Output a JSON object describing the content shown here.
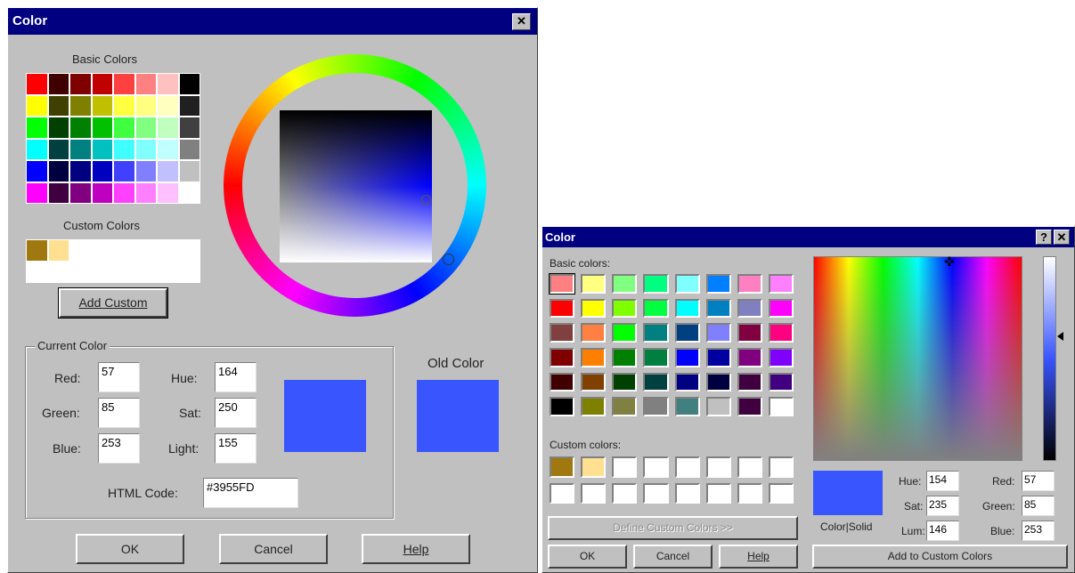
{
  "left_dialog": {
    "title": "Color",
    "close_glyph": "✕",
    "basic_colors_label": "Basic Colors",
    "custom_colors_label": "Custom Colors",
    "add_custom_label": "Add Custom",
    "current_color_label": "Current Color",
    "old_color_label": "Old Color",
    "red_label": "Red:",
    "green_label": "Green:",
    "blue_label": "Blue:",
    "hue_label": "Hue:",
    "sat_label": "Sat:",
    "light_label": "Light:",
    "red_value": "57",
    "green_value": "85",
    "blue_value": "253",
    "hue_value": "164",
    "sat_value": "250",
    "light_value": "155",
    "html_code_label": "HTML Code:",
    "html_code_value": "#3955FD",
    "current_color_hex": "#3955FD",
    "old_color_hex": "#3955FD",
    "ok_label": "OK",
    "cancel_label": "Cancel",
    "help_label": "Help",
    "basic_colors": [
      "#ff0000",
      "#400000",
      "#800000",
      "#c00000",
      "#ff4040",
      "#ff8080",
      "#ffc0c0",
      "#000000",
      "#ffff00",
      "#404000",
      "#808000",
      "#c0c000",
      "#ffff40",
      "#ffff80",
      "#ffffc0",
      "#202020",
      "#00ff00",
      "#004000",
      "#008000",
      "#00c000",
      "#40ff40",
      "#80ff80",
      "#c0ffc0",
      "#404040",
      "#00ffff",
      "#004040",
      "#008080",
      "#00c0c0",
      "#40ffff",
      "#80ffff",
      "#c0ffff",
      "#808080",
      "#0000ff",
      "#000040",
      "#000080",
      "#0000c0",
      "#4040ff",
      "#8080ff",
      "#c0c0ff",
      "#c0c0c0",
      "#ff00ff",
      "#400040",
      "#800080",
      "#c000c0",
      "#ff40ff",
      "#ff80ff",
      "#ffc0ff",
      "#ffffff"
    ],
    "custom_colors": [
      "#a07810",
      "#ffe090",
      "#ffffff",
      "#ffffff",
      "#ffffff",
      "#ffffff",
      "#ffffff",
      "#ffffff",
      "#ffffff",
      "#ffffff",
      "#ffffff",
      "#ffffff",
      "#ffffff",
      "#ffffff",
      "#ffffff",
      "#ffffff"
    ]
  },
  "right_dialog": {
    "title": "Color",
    "help_glyph": "?",
    "close_glyph": "✕",
    "basic_colors_label": "Basic colors:",
    "custom_colors_label": "Custom colors:",
    "define_custom_label": "Define Custom Colors >>",
    "color_solid_label": "Color|Solid",
    "hue_label": "Hue:",
    "sat_label": "Sat:",
    "lum_label": "Lum:",
    "red_label": "Red:",
    "green_label": "Green:",
    "blue_label": "Blue:",
    "hue_value": "154",
    "sat_value": "235",
    "lum_value": "146",
    "red_value": "57",
    "green_value": "85",
    "blue_value": "253",
    "ok_label": "OK",
    "cancel_label": "Cancel",
    "help_label": "Help",
    "add_to_custom_label": "Add to Custom Colors",
    "color_solid_hex": "#3955FD",
    "basic_colors": [
      "#ff8080",
      "#ffff80",
      "#80ff80",
      "#00ff80",
      "#80ffff",
      "#0080ff",
      "#ff80c0",
      "#ff80ff",
      "#ff0000",
      "#ffff00",
      "#80ff00",
      "#00ff40",
      "#00ffff",
      "#0080c0",
      "#8080c0",
      "#ff00ff",
      "#804040",
      "#ff8040",
      "#00ff00",
      "#008080",
      "#004080",
      "#8080ff",
      "#800040",
      "#ff0080",
      "#800000",
      "#ff8000",
      "#008000",
      "#008040",
      "#0000ff",
      "#0000a0",
      "#800080",
      "#8000ff",
      "#400000",
      "#804000",
      "#004000",
      "#004040",
      "#000080",
      "#000040",
      "#400040",
      "#400080",
      "#000000",
      "#808000",
      "#808040",
      "#808080",
      "#408080",
      "#c0c0c0",
      "#400040",
      "#ffffff"
    ],
    "custom_colors": [
      "#a07810",
      "#ffe090",
      "#ffffff",
      "#ffffff",
      "#ffffff",
      "#ffffff",
      "#ffffff",
      "#ffffff",
      "#ffffff",
      "#ffffff",
      "#ffffff",
      "#ffffff",
      "#ffffff",
      "#ffffff",
      "#ffffff",
      "#ffffff"
    ]
  }
}
